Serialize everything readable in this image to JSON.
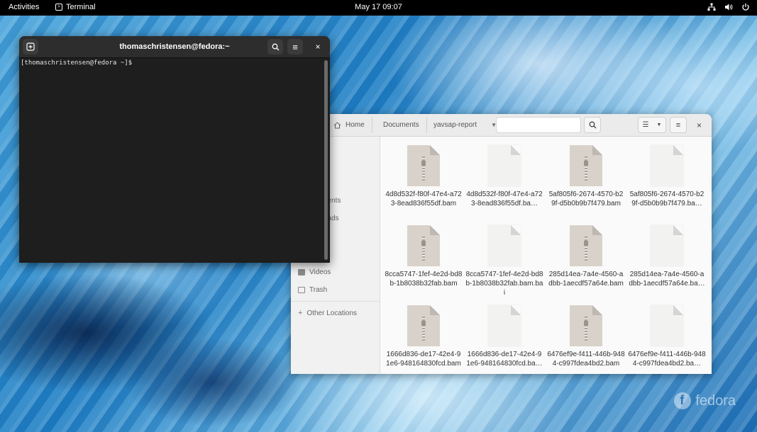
{
  "topbar": {
    "activities": "Activities",
    "app_name": "Terminal",
    "clock": "May 17  09:07"
  },
  "terminal": {
    "title": "thomaschristensen@fedora:~",
    "prompt": "[thomaschristensen@fedora ~]$"
  },
  "files": {
    "breadcrumbs": [
      "Home",
      "Documents",
      "yavsap-report"
    ],
    "sidebar": [
      {
        "label": "Videos",
        "icon": "video-icon"
      },
      {
        "label": "Trash",
        "icon": "trash-icon"
      },
      {
        "label": "Other Locations",
        "icon": "plus-icon"
      }
    ],
    "sidebar_partial": [
      "d",
      "nents",
      "oads",
      "s",
      "s"
    ],
    "items": [
      {
        "name": "4d8d532f-f80f-47e4-a723-8ead836f55df.bam",
        "type": "zip"
      },
      {
        "name": "4d8d532f-f80f-47e4-a723-8ead836f55df.ba…",
        "type": "plain"
      },
      {
        "name": "5af805f6-2674-4570-b29f-d5b0b9b7f479.bam",
        "type": "zip"
      },
      {
        "name": "5af805f6-2674-4570-b29f-d5b0b9b7f479.ba…",
        "type": "plain"
      },
      {
        "name": "8cca5747-1fef-4e2d-bd8b-1b8038b32fab.bam",
        "type": "zip"
      },
      {
        "name": "8cca5747-1fef-4e2d-bd8b-1b8038b32fab.bam.bai",
        "type": "plain"
      },
      {
        "name": "285d14ea-7a4e-4560-adbb-1aecdf57a64e.bam",
        "type": "zip"
      },
      {
        "name": "285d14ea-7a4e-4560-adbb-1aecdf57a64e.ba…",
        "type": "plain"
      },
      {
        "name": "1666d836-de17-42e4-91e6-948164830fcd.bam",
        "type": "zip"
      },
      {
        "name": "1666d836-de17-42e4-91e6-948164830fcd.ba…",
        "type": "plain"
      },
      {
        "name": "6476ef9e-f411-446b-9484-c997fdea4bd2.bam",
        "type": "zip"
      },
      {
        "name": "6476ef9e-f411-446b-9484-c997fdea4bd2.ba…",
        "type": "plain"
      }
    ]
  },
  "desktop": {
    "logo_text": "fedora"
  },
  "colors": {
    "topbar": "#000000",
    "terminal_bg": "#1e1e1e",
    "files_bg": "#fafafa"
  }
}
